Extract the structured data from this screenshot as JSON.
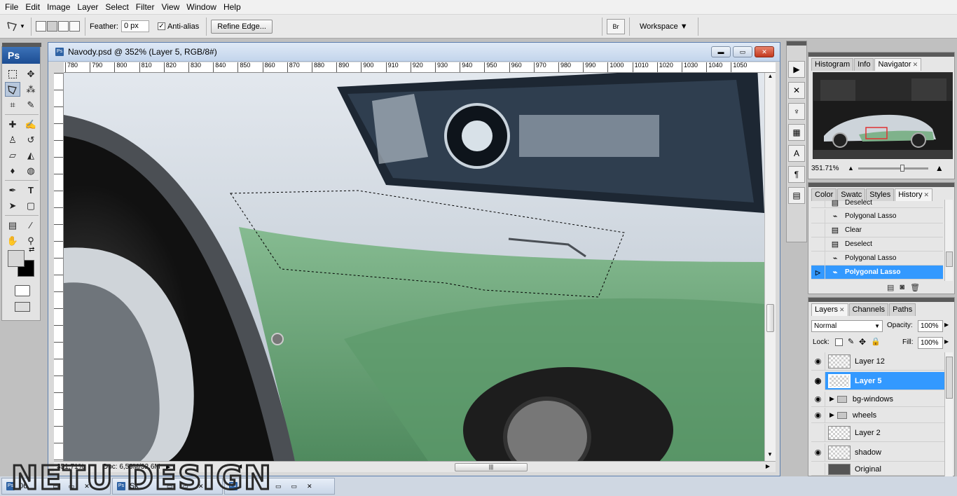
{
  "menu": [
    "File",
    "Edit",
    "Image",
    "Layer",
    "Select",
    "Filter",
    "View",
    "Window",
    "Help"
  ],
  "options": {
    "feather_label": "Feather:",
    "feather_value": "0 px",
    "antialias_label": "Anti-alias",
    "refine_edge": "Refine Edge...",
    "workspace": "Workspace ▼"
  },
  "tools": {
    "logo": "Ps"
  },
  "document": {
    "title": "Navody.psd @ 352% (Layer 5, RGB/8#)",
    "ruler_ticks": [
      "780",
      "790",
      "800",
      "810",
      "820",
      "830",
      "840",
      "850",
      "860",
      "870",
      "880",
      "890",
      "900",
      "910",
      "920",
      "930",
      "940",
      "950",
      "960",
      "970",
      "980",
      "990",
      "1000",
      "1010",
      "1020",
      "1030",
      "1040",
      "1050"
    ],
    "zoom": "351,71%",
    "doc_size": "Doc: 6,59M/32,6M"
  },
  "navigator": {
    "tabs": [
      "Histogram",
      "Info",
      "Navigator"
    ],
    "zoom": "351.71%"
  },
  "history": {
    "tabs": [
      "Color",
      "Swatc",
      "Styles",
      "History"
    ],
    "items": [
      {
        "label": "Deselect",
        "icon": "document-icon"
      },
      {
        "label": "Polygonal Lasso",
        "icon": "lasso-icon"
      },
      {
        "label": "Clear",
        "icon": "document-icon"
      },
      {
        "label": "Deselect",
        "icon": "document-icon"
      },
      {
        "label": "Polygonal Lasso",
        "icon": "lasso-icon"
      },
      {
        "label": "Polygonal Lasso",
        "icon": "lasso-icon",
        "selected": true
      }
    ]
  },
  "layers": {
    "tabs": [
      "Layers",
      "Channels",
      "Paths"
    ],
    "blend_mode": "Normal",
    "opacity_label": "Opacity:",
    "opacity_value": "100%",
    "lock_label": "Lock:",
    "fill_label": "Fill:",
    "fill_value": "100%",
    "items": [
      {
        "name": "Layer 12",
        "visible": true,
        "type": "layer"
      },
      {
        "name": "Layer 5",
        "visible": true,
        "type": "layer",
        "selected": true
      },
      {
        "name": "bg-windows",
        "visible": true,
        "type": "group"
      },
      {
        "name": "wheels",
        "visible": true,
        "type": "group"
      },
      {
        "name": "Layer 2",
        "visible": false,
        "type": "layer"
      },
      {
        "name": "shadow",
        "visible": true,
        "type": "layer"
      },
      {
        "name": "Original",
        "visible": false,
        "type": "layer"
      }
    ]
  },
  "taskbar": [
    "06",
    "Sk",
    ""
  ],
  "watermark": "NETU DESIGN",
  "colors": {
    "selection": "#3399ff",
    "car_green": "#6fa67a",
    "car_silver": "#c9d2da"
  }
}
